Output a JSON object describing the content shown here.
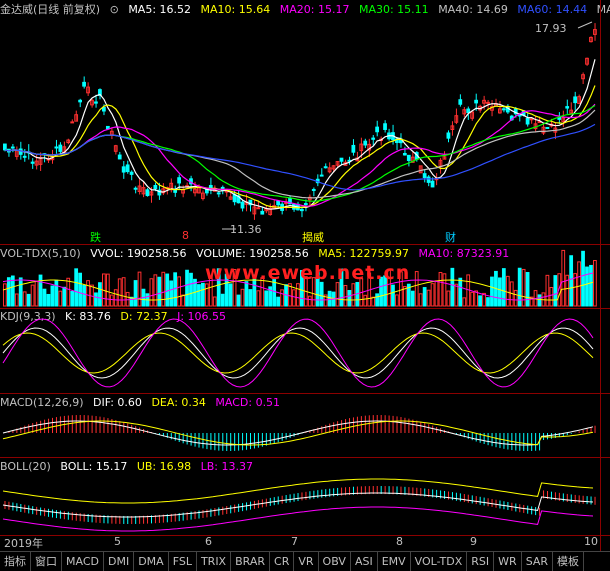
{
  "main_header": {
    "stock": "金达威(日线 前复权)",
    "ma5": "MA5: 16.52",
    "ma10": "MA10: 15.64",
    "ma20": "MA20: 15.17",
    "ma30": "MA30: 15.11",
    "ma40": "MA40: 14.69",
    "ma60": "MA60: 14.44",
    "ma_more": "MA",
    "colors": {
      "ma5": "#ffffff",
      "ma10": "#ffff00",
      "ma20": "#ff00ff",
      "ma30": "#00ff00",
      "ma40": "#c0c0c0",
      "ma60": "#3050ff"
    }
  },
  "price_labels": {
    "high": "17.93",
    "low": "11.36"
  },
  "events": [
    {
      "label": "跌",
      "color": "#00ff00"
    },
    {
      "label": "8",
      "color": "#ff3030"
    },
    {
      "label": "揭威",
      "color": "#ffff00"
    },
    {
      "label": "财",
      "color": "#00ccff"
    }
  ],
  "vol_header": {
    "name": "VOL-TDX(5,10)",
    "vvol": "VVOL: 190258.56",
    "volume": "VOLUME: 190258.56",
    "ma5": "MA5: 122759.97",
    "ma10": "MA10: 87323.91"
  },
  "watermark": "www.eweb.net.cn",
  "kdj_header": {
    "name": "KDJ(9,3,3)",
    "k": "K: 83.76",
    "d": "D: 72.37",
    "j": "J: 106.55"
  },
  "macd_header": {
    "name": "MACD(12,26,9)",
    "dif": "DIF: 0.60",
    "dea": "DEA: 0.34",
    "macd": "MACD: 0.51"
  },
  "boll_header": {
    "name": "BOLL(20)",
    "boll": "BOLL: 15.17",
    "ub": "UB: 16.98",
    "lb": "LB: 13.37"
  },
  "xaxis": [
    "2019年",
    "5",
    "6",
    "7",
    "8",
    "9",
    "10"
  ],
  "tabs": [
    "指标",
    "窗口",
    "MACD",
    "DMI",
    "DMA",
    "FSL",
    "TRIX",
    "BRAR",
    "CR",
    "VR",
    "OBV",
    "ASI",
    "EMV",
    "VOL-TDX",
    "RSI",
    "WR",
    "SAR",
    "模板"
  ]
}
